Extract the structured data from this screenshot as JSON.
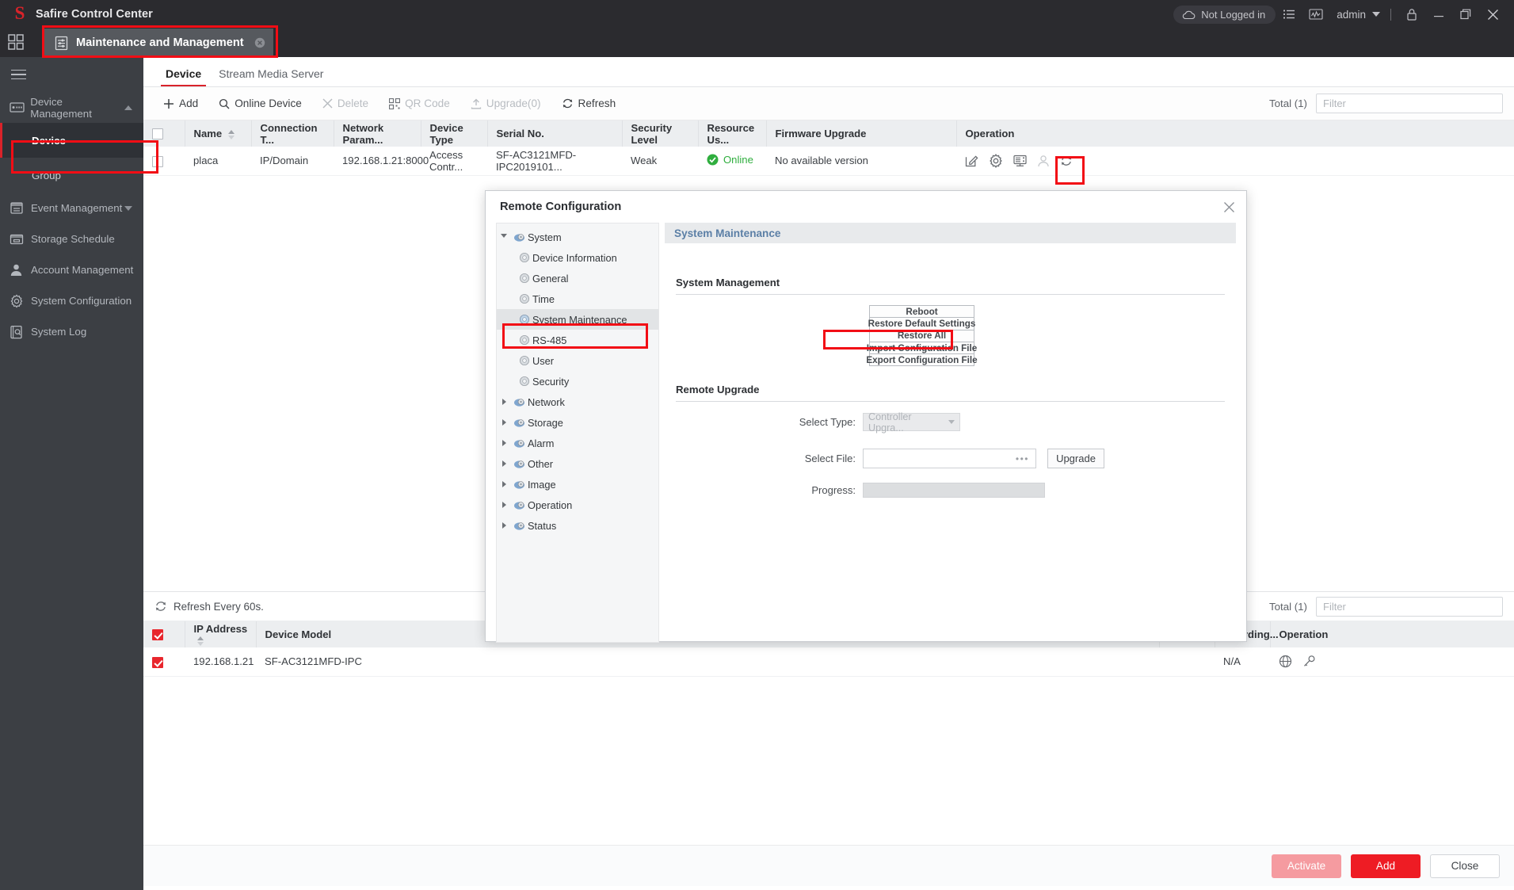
{
  "titlebar": {
    "app_title": "Safire Control Center",
    "logo": "safire-s-logo",
    "login_status": "Not Logged in",
    "user": "admin",
    "icons": [
      "cloud-icon",
      "list-icon",
      "chart-icon",
      "chevron-down-icon",
      "lock-icon",
      "minimize-icon",
      "maximize-icon",
      "close-icon"
    ]
  },
  "tab_bar": {
    "tabs": [
      {
        "label": "Maintenance and Management",
        "icon": "sliders-icon",
        "closable": true,
        "active": true
      }
    ]
  },
  "sidebar": {
    "menu_icon": "hamburger-icon",
    "groups": [
      {
        "label": "Device Management",
        "icon": "device-management-icon",
        "expanded": true,
        "caret": "chevron-up-icon",
        "children": [
          {
            "label": "Device",
            "active": true
          },
          {
            "label": "Group",
            "active": false
          }
        ]
      },
      {
        "label": "Event Management",
        "icon": "event-icon",
        "expanded": false,
        "caret": "chevron-down-icon",
        "children": []
      },
      {
        "label": "Storage Schedule",
        "icon": "storage-icon",
        "children": []
      },
      {
        "label": "Account Management",
        "icon": "account-icon",
        "children": []
      },
      {
        "label": "System Configuration",
        "icon": "gear-icon",
        "children": []
      },
      {
        "label": "System Log",
        "icon": "log-icon",
        "children": []
      }
    ]
  },
  "content_tabs": [
    {
      "label": "Device",
      "active": true
    },
    {
      "label": "Stream Media Server",
      "active": false
    }
  ],
  "toolbar": {
    "buttons": [
      {
        "label": "Add",
        "icon": "plus-icon",
        "enabled": true
      },
      {
        "label": "Online Device",
        "icon": "search-icon",
        "enabled": true
      },
      {
        "label": "Delete",
        "icon": "close-icon",
        "enabled": false
      },
      {
        "label": "QR Code",
        "icon": "qrcode-icon",
        "enabled": false
      },
      {
        "label": "Upgrade(0)",
        "icon": "upload-icon",
        "enabled": false
      },
      {
        "label": "Refresh",
        "icon": "refresh-icon",
        "enabled": true
      }
    ],
    "total_label": "Total (1)",
    "filter_placeholder": "Filter",
    "filter_value": ""
  },
  "device_table": {
    "columns": [
      "",
      "Name",
      "Connection T...",
      "Network Param...",
      "Device Type",
      "Serial No.",
      "Security Level",
      "Resource Us...",
      "Firmware Upgrade",
      "Operation"
    ],
    "rows": [
      {
        "checked": false,
        "name": "placa",
        "connection_type": "IP/Domain",
        "network_params": "192.168.1.21:8000",
        "device_type": "Access Contr...",
        "serial_no": "SF-AC3121MFD-IPC2019101...",
        "security_level": "Weak",
        "resource_usage": "Online",
        "firmware_upgrade": "No available version",
        "operation_icons": [
          "edit-icon",
          "gear-icon",
          "server-icon",
          "user-icon",
          "refresh-icon"
        ]
      }
    ]
  },
  "bottom_panel": {
    "refresh_label": "Refresh Every 60s.",
    "refresh_icon": "refresh-icon",
    "total_label": "Total (1)",
    "filter_placeholder": "Filter",
    "columns_left": [
      "",
      "IP Address",
      "Device Model"
    ],
    "columns_right": [
      "...",
      "Guarding...",
      "Operation"
    ],
    "rows": [
      {
        "checked": true,
        "ip_address": "192.168.1.21",
        "device_model": "SF-AC3121MFD-IPC",
        "guarding": "N/A",
        "operation_icons": [
          "globe-icon",
          "key-icon"
        ]
      }
    ],
    "footer_buttons": [
      {
        "label": "Activate",
        "style": "disabled-primary"
      },
      {
        "label": "Add",
        "style": "primary"
      },
      {
        "label": "Close",
        "style": "secondary"
      }
    ]
  },
  "modal": {
    "title": "Remote Configuration",
    "close_icon": "close-icon",
    "tree": [
      {
        "label": "System",
        "level": 0,
        "expanded": true,
        "icon": "system-node-icon",
        "selected": false
      },
      {
        "label": "Device Information",
        "level": 1,
        "icon": "gear-node-icon",
        "selected": false
      },
      {
        "label": "General",
        "level": 1,
        "icon": "gear-node-icon",
        "selected": false
      },
      {
        "label": "Time",
        "level": 1,
        "icon": "gear-node-icon",
        "selected": false
      },
      {
        "label": "System Maintenance",
        "level": 1,
        "icon": "gear-node-icon",
        "selected": true
      },
      {
        "label": "RS-485",
        "level": 1,
        "icon": "gear-node-icon",
        "selected": false
      },
      {
        "label": "User",
        "level": 1,
        "icon": "gear-node-icon",
        "selected": false
      },
      {
        "label": "Security",
        "level": 1,
        "icon": "gear-node-icon",
        "selected": false
      },
      {
        "label": "Network",
        "level": 0,
        "expanded": false,
        "icon": "system-node-icon",
        "selected": false
      },
      {
        "label": "Storage",
        "level": 0,
        "expanded": false,
        "icon": "system-node-icon",
        "selected": false
      },
      {
        "label": "Alarm",
        "level": 0,
        "expanded": false,
        "icon": "system-node-icon",
        "selected": false
      },
      {
        "label": "Other",
        "level": 0,
        "expanded": false,
        "icon": "system-node-icon",
        "selected": false
      },
      {
        "label": "Image",
        "level": 0,
        "expanded": false,
        "icon": "system-node-icon",
        "selected": false
      },
      {
        "label": "Operation",
        "level": 0,
        "expanded": false,
        "icon": "system-node-icon",
        "selected": false
      },
      {
        "label": "Status",
        "level": 0,
        "expanded": false,
        "icon": "system-node-icon",
        "selected": false
      }
    ],
    "panel_header": "System Maintenance",
    "system_management": {
      "title": "System Management",
      "buttons": [
        {
          "label": "Reboot",
          "highlighted": false
        },
        {
          "label": "Restore Default Settings",
          "highlighted": false
        },
        {
          "label": "Restore All",
          "highlighted": true
        },
        {
          "label": "Import Configuration File",
          "highlighted": false
        },
        {
          "label": "Export Configuration File",
          "highlighted": false
        }
      ]
    },
    "remote_upgrade": {
      "title": "Remote Upgrade",
      "select_type_label": "Select Type:",
      "select_type_value": "Controller Upgra...",
      "select_file_label": "Select File:",
      "select_file_value": "",
      "browse_label": "•••",
      "upgrade_button": "Upgrade",
      "progress_label": "Progress:",
      "progress_value": ""
    }
  },
  "annotations": {
    "color": "#f20d15",
    "highlights": [
      "tab-maintenance-and-management",
      "sidebar-item-device",
      "operation-gear-icon",
      "tree-item-system-maintenance",
      "restore-all-button"
    ]
  }
}
